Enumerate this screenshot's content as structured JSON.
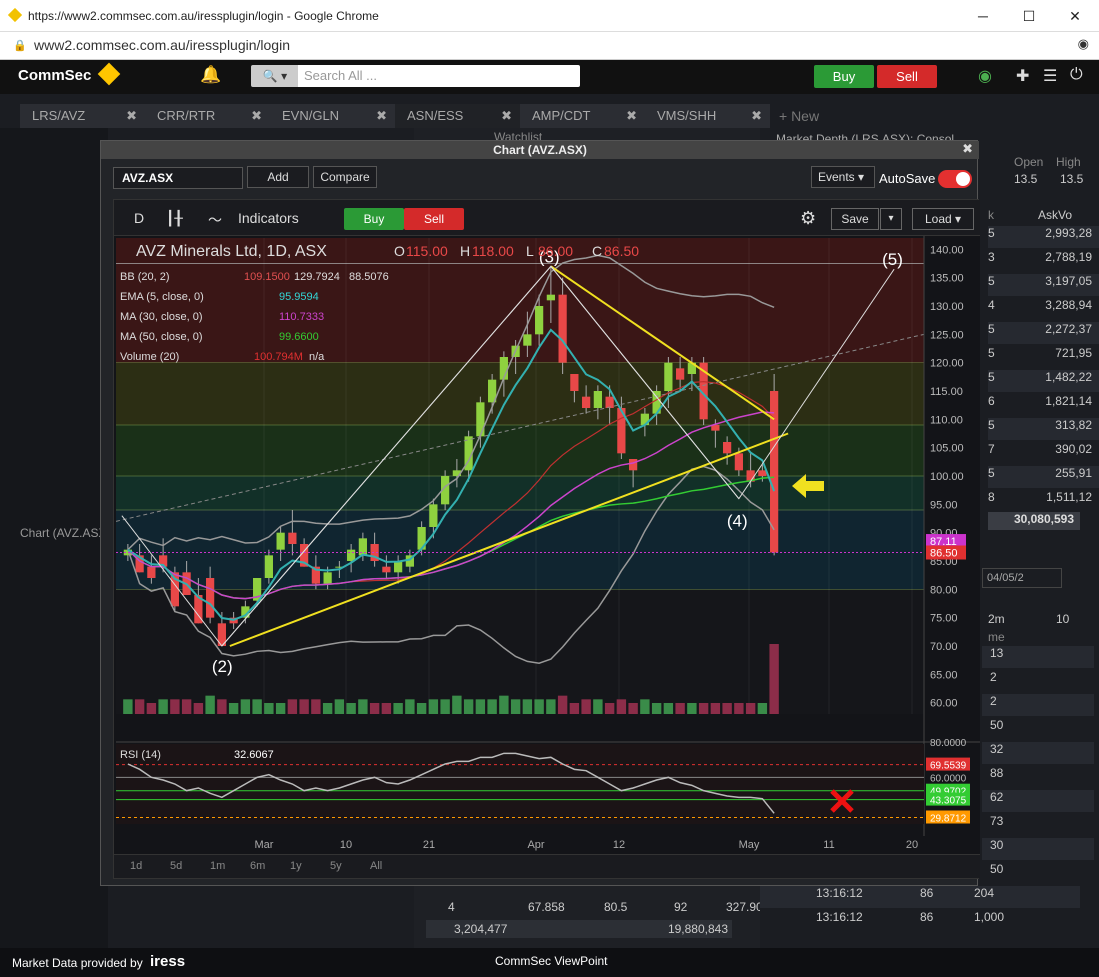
{
  "browser": {
    "title": "https://www2.commsec.com.au/iressplugin/login - Google Chrome",
    "url": "www2.commsec.com.au/iressplugin/login"
  },
  "topbar": {
    "brand": "CommSec",
    "search_placeholder": "Search All ...",
    "buy_label": "Buy",
    "sell_label": "Sell"
  },
  "tabs": [
    {
      "label": "LRS/AVZ"
    },
    {
      "label": "CRR/RTR"
    },
    {
      "label": "EVN/GLN"
    },
    {
      "label": "ASN/ESS"
    },
    {
      "label": "AMP/CDT"
    },
    {
      "label": "VMS/SHH"
    }
  ],
  "new_tab_label": "+ New",
  "left_panel_label": "Chart (AVZ.ASX",
  "watchlist_title": "Watchlist",
  "market_depth": {
    "title": "Market Depth (LRS.ASX): Consol...",
    "open_label": "Open",
    "open_value": "13.5",
    "high_label": "High",
    "high_value": "13.5",
    "col_k": "k",
    "col_askvol": "AskVo",
    "rows": [
      [
        "5",
        "2,993,28"
      ],
      [
        "3",
        "2,788,19"
      ],
      [
        "5",
        "3,197,05"
      ],
      [
        "4",
        "3,288,94"
      ],
      [
        "5",
        "2,272,37"
      ],
      [
        "5",
        "721,95"
      ],
      [
        "5",
        "1,482,22"
      ],
      [
        "6",
        "1,821,14"
      ],
      [
        "5",
        "313,82"
      ],
      [
        "7",
        "390,02"
      ],
      [
        "5",
        "255,91"
      ],
      [
        "8",
        "1,511,12"
      ]
    ],
    "total": "30,080,593",
    "date_field": "04/05/2",
    "time_label": "2m",
    "time_col2": "10",
    "me_label": "me",
    "lower_rows": [
      "13",
      "2",
      "2",
      "50",
      "32",
      "88",
      "62",
      "73",
      "30",
      "50"
    ],
    "trades": [
      {
        "time": "13:16:12",
        "price": "86",
        "vol": "204"
      },
      {
        "time": "13:16:12",
        "price": "86",
        "vol": "1,000"
      }
    ]
  },
  "watchlist_bottom": {
    "row": [
      "4",
      "67.858",
      "80.5",
      "92",
      "327.90"
    ],
    "totals": [
      "3,204,477",
      "19,880,843"
    ]
  },
  "chart_window": {
    "title": "Chart (AVZ.ASX)",
    "symbol": "AVZ.ASX",
    "add_label": "Add",
    "compare_label": "Compare",
    "events_label": "Events",
    "autosave_label": "AutoSave",
    "interval_label": "D",
    "indicators_label": "Indicators",
    "buy_label": "Buy",
    "sell_label": "Sell",
    "save_label": "Save",
    "load_label": "Load",
    "periods": [
      "1d",
      "5d",
      "1m",
      "6m",
      "1y",
      "5y",
      "All"
    ]
  },
  "chart_data": {
    "type": "candlestick",
    "title": "AVZ Minerals Ltd, 1D, ASX",
    "ohlc_header": {
      "O": "115.00",
      "H": "118.00",
      "L": "86.00",
      "C": "86.50"
    },
    "indicators": [
      {
        "name": "BB (20, 2)",
        "values": [
          "109.1500",
          "129.7924",
          "88.5076"
        ],
        "color": "#e05050"
      },
      {
        "name": "EMA (5, close, 0)",
        "values": [
          "95.9594"
        ],
        "color": "#33d6d6"
      },
      {
        "name": "MA (30, close, 0)",
        "values": [
          "110.7333"
        ],
        "color": "#cc44cc"
      },
      {
        "name": "MA (50, close, 0)",
        "values": [
          "99.6600"
        ],
        "color": "#33cc33"
      },
      {
        "name": "Volume (20)",
        "values": [
          "100.794M",
          "n/a"
        ],
        "color": "#e03030"
      }
    ],
    "y_ticks": [
      "140.00",
      "135.00",
      "130.00",
      "125.00",
      "120.00",
      "115.00",
      "110.00",
      "105.00",
      "100.00",
      "95.00",
      "90.00",
      "85.00",
      "80.00",
      "75.00",
      "70.00",
      "65.00",
      "60.00"
    ],
    "ylim": [
      58,
      142
    ],
    "x_ticks": [
      "Mar",
      "10",
      "21",
      "Apr",
      "12",
      "May",
      "11",
      "20"
    ],
    "price_tags": [
      {
        "value": 87.11,
        "label": "87.11",
        "color": "#cc33cc"
      },
      {
        "value": 86.5,
        "label": "86.50",
        "color": "#e03030"
      }
    ],
    "candles": [
      [
        86,
        88,
        85,
        87
      ],
      [
        86,
        88,
        83,
        83
      ],
      [
        84,
        86,
        81,
        82
      ],
      [
        86,
        89,
        83,
        84
      ],
      [
        83,
        84,
        76,
        77
      ],
      [
        83,
        85,
        79,
        79
      ],
      [
        79,
        82,
        74,
        74
      ],
      [
        82,
        84,
        74,
        75
      ],
      [
        74,
        76,
        70,
        70
      ],
      [
        75,
        76,
        73,
        74
      ],
      [
        75,
        78,
        74,
        77
      ],
      [
        78,
        82,
        77,
        82
      ],
      [
        82,
        87,
        81,
        86
      ],
      [
        87,
        91,
        85,
        90
      ],
      [
        90,
        94,
        86,
        88
      ],
      [
        88,
        89,
        84,
        84
      ],
      [
        84,
        86,
        80,
        81
      ],
      [
        81,
        84,
        80,
        83
      ],
      [
        84,
        85,
        82,
        84
      ],
      [
        85,
        88,
        83,
        87
      ],
      [
        86,
        90,
        85,
        89
      ],
      [
        88,
        90,
        84,
        85
      ],
      [
        84,
        86,
        82,
        83
      ],
      [
        83,
        86,
        81,
        85
      ],
      [
        84,
        87,
        83,
        86
      ],
      [
        87,
        92,
        86,
        91
      ],
      [
        91,
        96,
        89,
        95
      ],
      [
        95,
        101,
        94,
        100
      ],
      [
        100,
        103,
        98,
        101
      ],
      [
        101,
        108,
        99,
        107
      ],
      [
        107,
        114,
        105,
        113
      ],
      [
        113,
        118,
        111,
        117
      ],
      [
        117,
        122,
        114,
        121
      ],
      [
        121,
        124,
        118,
        123
      ],
      [
        123,
        129,
        121,
        125
      ],
      [
        125,
        132,
        123,
        130
      ],
      [
        131,
        137,
        127,
        132
      ],
      [
        132,
        135,
        118,
        120
      ],
      [
        118,
        118,
        113,
        115
      ],
      [
        114,
        116,
        111,
        112
      ],
      [
        112,
        116,
        110,
        115
      ],
      [
        114,
        116,
        109,
        112
      ],
      [
        112,
        114,
        103,
        104
      ],
      [
        103,
        103,
        98,
        101
      ],
      [
        109,
        112,
        107,
        111
      ],
      [
        111,
        116,
        109,
        115
      ],
      [
        115,
        121,
        112,
        120
      ],
      [
        119,
        121,
        115,
        117
      ],
      [
        118,
        121,
        115,
        120
      ],
      [
        120,
        121,
        109,
        110
      ],
      [
        109,
        110,
        105,
        108
      ],
      [
        106,
        107,
        102,
        104
      ],
      [
        104,
        105,
        100,
        101
      ],
      [
        101,
        104,
        98,
        99
      ],
      [
        101,
        102,
        99,
        100
      ],
      [
        115,
        118,
        86,
        86.5
      ]
    ],
    "volumes": [
      2,
      2,
      1.5,
      2,
      2,
      2,
      1.5,
      2.5,
      2,
      1.5,
      2,
      2,
      1.5,
      1.5,
      2,
      2,
      2,
      1.5,
      2,
      1.5,
      2,
      1.5,
      1.5,
      1.5,
      2,
      1.5,
      2,
      2,
      2.5,
      2,
      2,
      2,
      2.5,
      2,
      2,
      2,
      2,
      2.5,
      1.5,
      2,
      2,
      1.5,
      2,
      1.5,
      2,
      1.5,
      1.5,
      1.5,
      1.5,
      1.5,
      1.5,
      1.5,
      1.5,
      1.5,
      1.5,
      14
    ],
    "volume_colors": [
      "#44aa55",
      "#aa3355",
      "#aa3355",
      "#44aa55",
      "#aa3355",
      "#aa3355",
      "#aa3355",
      "#44aa55",
      "#aa3355",
      "#44aa55",
      "#44aa55",
      "#44aa55",
      "#44aa55",
      "#44aa55",
      "#aa3355",
      "#aa3355",
      "#aa3355",
      "#44aa55",
      "#44aa55",
      "#44aa55",
      "#44aa55",
      "#aa3355",
      "#aa3355",
      "#44aa55",
      "#44aa55",
      "#44aa55",
      "#44aa55",
      "#44aa55",
      "#44aa55",
      "#44aa55",
      "#44aa55",
      "#44aa55",
      "#44aa55",
      "#44aa55",
      "#44aa55",
      "#44aa55",
      "#44aa55",
      "#aa3355",
      "#aa3355",
      "#aa3355",
      "#44aa55",
      "#aa3355",
      "#aa3355",
      "#aa3355",
      "#44aa55",
      "#44aa55",
      "#44aa55",
      "#aa3355",
      "#44aa55",
      "#aa3355",
      "#aa3355",
      "#aa3355",
      "#aa3355",
      "#aa3355",
      "#44aa55",
      "#aa3355"
    ],
    "wave_labels": [
      "(2)",
      "(3)",
      "(4)",
      "(5)"
    ],
    "rsi": {
      "label": "RSI (14)",
      "value": "32.6067",
      "ticks": [
        "80.0000",
        "60.0000",
        "43.3075",
        "29.8712"
      ],
      "tags": [
        {
          "label": "69.5539",
          "color": "#e03030"
        },
        {
          "label": "49.9702",
          "color": "#33cc33"
        },
        {
          "label": "43.3075",
          "color": "#33cc33"
        },
        {
          "label": "29.8712",
          "color": "#ff9900"
        }
      ],
      "values": [
        70,
        66,
        60,
        58,
        55,
        50,
        52,
        48,
        45,
        50,
        55,
        60,
        62,
        58,
        55,
        50,
        52,
        50,
        52,
        55,
        58,
        60,
        56,
        55,
        58,
        62,
        66,
        70,
        72,
        72,
        75,
        75,
        78,
        78,
        76,
        74,
        75,
        70,
        66,
        65,
        60,
        55,
        50,
        52,
        55,
        58,
        60,
        56,
        54,
        50,
        48,
        46,
        45,
        45,
        44,
        33
      ]
    }
  },
  "statusbar": {
    "left": "Market Data provided by",
    "brand": "iress",
    "center": "CommSec ViewPoint"
  }
}
